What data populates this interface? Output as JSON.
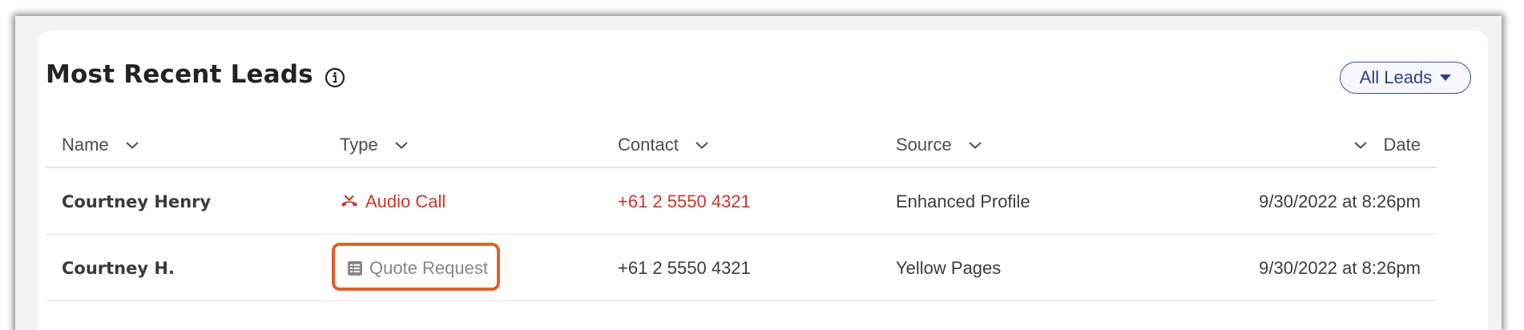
{
  "card": {
    "title": "Most Recent Leads",
    "filter_button_label": "All Leads"
  },
  "table": {
    "columns": [
      {
        "key": "name",
        "label": "Name"
      },
      {
        "key": "type",
        "label": "Type"
      },
      {
        "key": "contact",
        "label": "Contact"
      },
      {
        "key": "source",
        "label": "Source"
      },
      {
        "key": "date",
        "label": "Date"
      }
    ],
    "rows": [
      {
        "name": "Courtney Henry",
        "type": "Audio Call",
        "type_icon": "phone-missed-icon",
        "contact": "+61 2 5550 4321",
        "source": "Enhanced Profile",
        "date": "9/30/2022 at 8:26pm"
      },
      {
        "name": "Courtney H.",
        "type": "Quote Request",
        "type_icon": "form-document-icon",
        "contact": "+61 2 5550 4321",
        "source": "Yellow Pages",
        "date": "9/30/2022 at 8:26pm"
      }
    ]
  },
  "colors": {
    "accent_red": "#c8372d",
    "accent_blue": "#2d3d8a",
    "highlight_orange": "#e15f2a"
  }
}
